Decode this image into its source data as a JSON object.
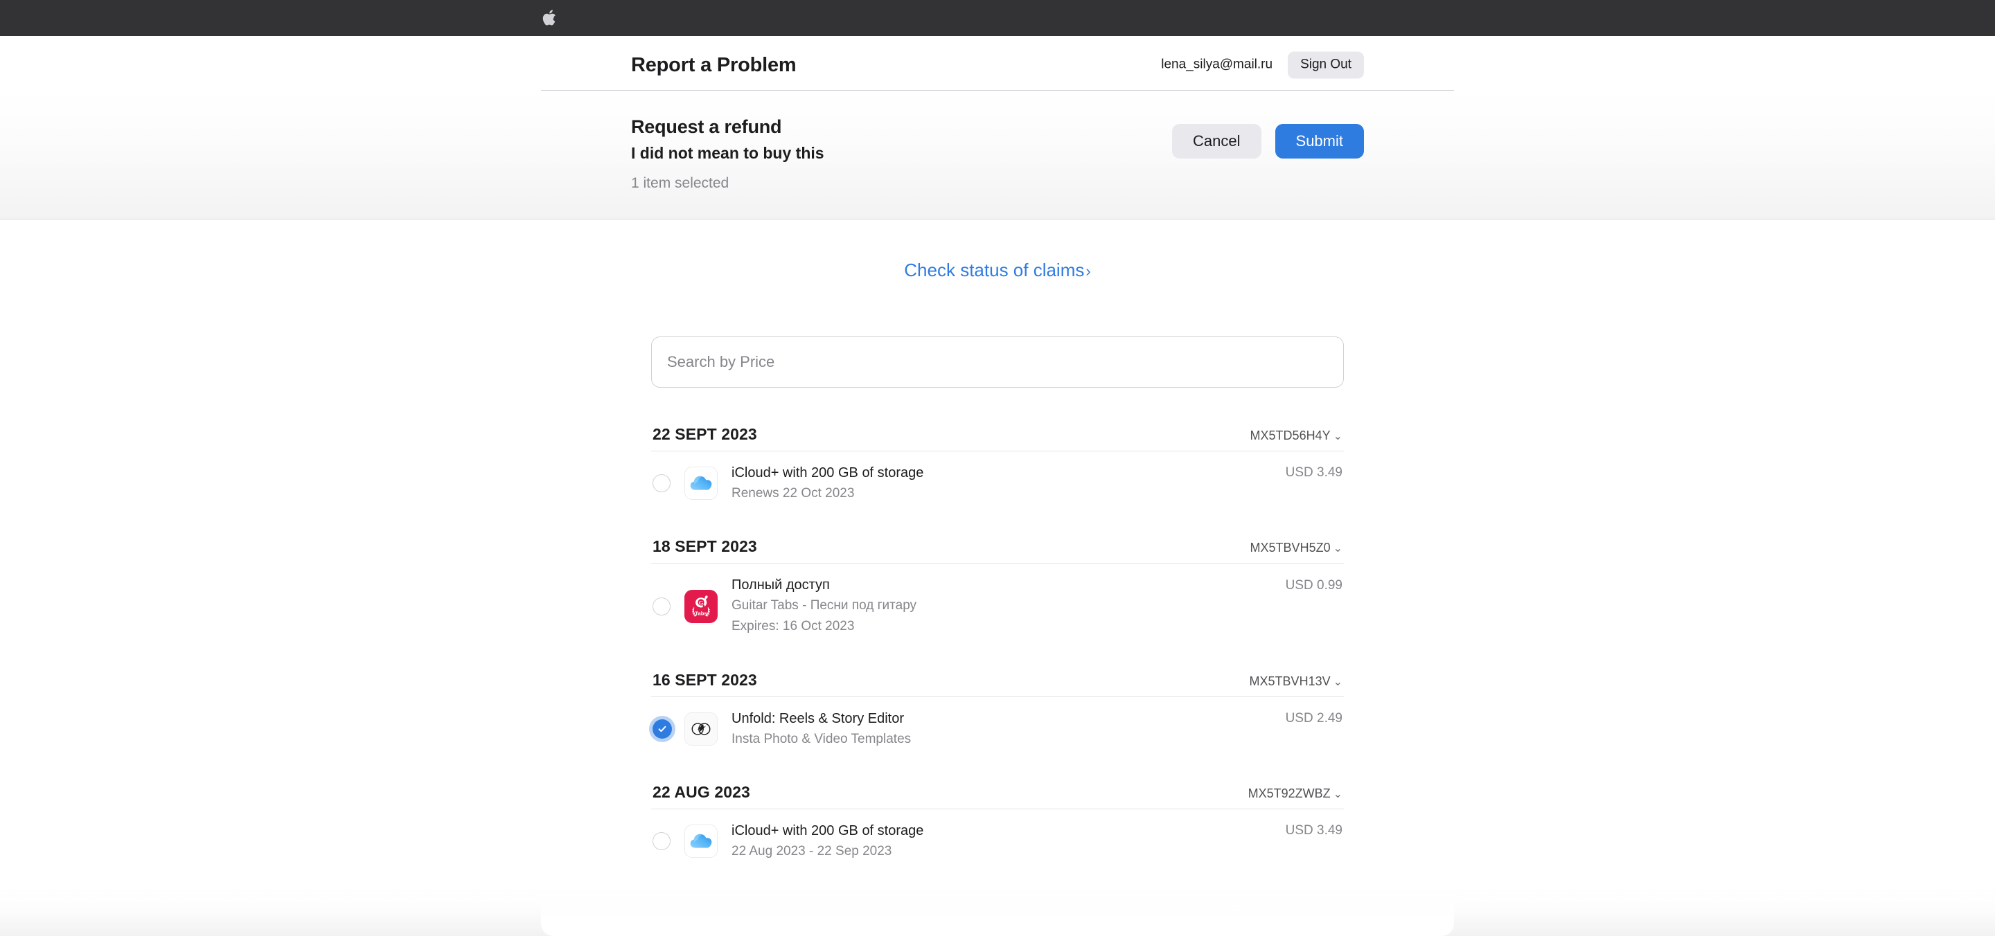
{
  "globalnav": {
    "logo": "apple-logo-icon"
  },
  "header": {
    "title": "Report a Problem",
    "email": "lena_silya@mail.ru",
    "sign_out_label": "Sign Out"
  },
  "refund_banner": {
    "title": "Request a refund",
    "reason": "I did not mean to buy this",
    "selection_count": "1 item selected",
    "cancel_label": "Cancel",
    "submit_label": "Submit",
    "submit_color": "#2f7ce0"
  },
  "claims": {
    "label": "Check status of claims",
    "chevron": "›",
    "color": "#2f7ce0"
  },
  "search": {
    "placeholder": "Search by Price",
    "value": ""
  },
  "purchase_groups": [
    {
      "date": "22 SEPT 2023",
      "order_id": "MX5TD56H4Y",
      "chevron": "⌄",
      "items": [
        {
          "icon": "icloud-icon",
          "title": "iCloud+ with 200 GB of storage",
          "subtitle": "Renews 22 Oct 2023",
          "subtitle2": "",
          "price": "USD 3.49",
          "selected": false
        }
      ]
    },
    {
      "date": "18 SEPT 2023",
      "order_id": "MX5TBVH5Z0",
      "chevron": "⌄",
      "items": [
        {
          "icon": "guitar-tabs-icon",
          "title": "Полный доступ",
          "subtitle": "Guitar Tabs - Песни под гитару",
          "subtitle2": "Expires: 16 Oct 2023",
          "price": "USD 0.99",
          "selected": false
        }
      ]
    },
    {
      "date": "16 SEPT 2023",
      "order_id": "MX5TBVH13V",
      "chevron": "⌄",
      "items": [
        {
          "icon": "unfold-icon",
          "title": "Unfold: Reels & Story Editor",
          "subtitle": "Insta Photo & Video Templates",
          "subtitle2": "",
          "price": "USD 2.49",
          "selected": true
        }
      ]
    },
    {
      "date": "22 AUG 2023",
      "order_id": "MX5T92ZWBZ",
      "chevron": "⌄",
      "items": [
        {
          "icon": "icloud-icon",
          "title": "iCloud+ with 200 GB of storage",
          "subtitle": "22 Aug 2023 - 22 Sep 2023",
          "subtitle2": "",
          "price": "USD 3.49",
          "selected": false
        }
      ]
    }
  ]
}
